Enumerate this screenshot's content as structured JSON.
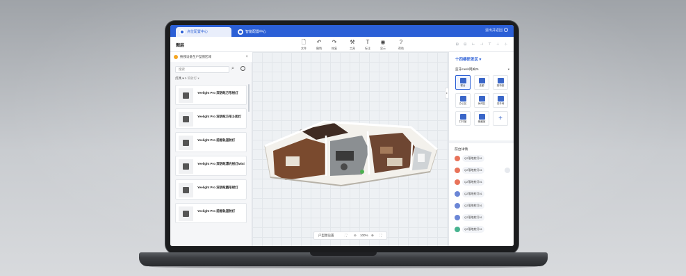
{
  "tabs": [
    {
      "label": "点位配置中心"
    },
    {
      "label": "智能配置中心"
    }
  ],
  "header_right": "退出并返回",
  "toolbar": {
    "title": "图层",
    "tools": [
      {
        "label": "文件",
        "icon": "file-icon"
      },
      {
        "label": "撤销",
        "icon": "undo-icon"
      },
      {
        "label": "恢复",
        "icon": "redo-icon"
      },
      {
        "label": "工具",
        "icon": "tool-icon"
      },
      {
        "label": "标注",
        "icon": "text-icon"
      },
      {
        "label": "显示",
        "icon": "eye-icon"
      },
      {
        "label": "帮助",
        "icon": "help-icon"
      }
    ],
    "right_icons": "⊞ ⊟ ⊢ ⊣ ⊤ ⊥ ⊹"
  },
  "left_panel": {
    "notice": "拖拽设备至户型图区域",
    "search_placeholder": "搜索",
    "breadcrumb_main": "灯具",
    "breadcrumb_sub": "筒射灯",
    "products": [
      {
        "name": "Yeelight Pro 深防眩方形射灯"
      },
      {
        "name": "Yeelight Pro 深防眩方形斗胆灯"
      },
      {
        "name": "Yeelight Pro 前舱轨道射灯"
      },
      {
        "name": "Yeelight Pro 深防眩漂光射灯Mini"
      },
      {
        "name": "Yeelight Pro 深防眩圆形射灯"
      },
      {
        "name": "Yeelight Pro 前舱轨道射灯"
      }
    ]
  },
  "canvas": {
    "zoom_label": "户型图设置",
    "zoom_value": "100%"
  },
  "right_panel": {
    "zone_title": "十四楼研发区",
    "selected_device": "蓝牙mesh网关01",
    "zones": [
      {
        "label": "餐台"
      },
      {
        "label": "走廊"
      },
      {
        "label": "接待室"
      },
      {
        "label": "办公区"
      },
      {
        "label": "休闲区"
      },
      {
        "label": "洗手间"
      },
      {
        "label": "打印室"
      },
      {
        "label": "储藏室"
      }
    ],
    "detail_title": "前台详情",
    "details": [
      {
        "label": "Q2落地射灯01",
        "color": "#e8735a"
      },
      {
        "label": "Q2落地射灯01",
        "color": "#e8735a"
      },
      {
        "label": "Q2落地射灯01",
        "color": "#e8735a"
      },
      {
        "label": "Q2落地射灯01",
        "color": "#6b86d6"
      },
      {
        "label": "Q2落地射灯01",
        "color": "#6b86d6"
      },
      {
        "label": "Q2落地射灯01",
        "color": "#6b86d6"
      },
      {
        "label": "Q2落地射灯01",
        "color": "#47b38f"
      }
    ]
  },
  "colors": {
    "accent": "#2b5fd6",
    "floor_wood": "#7a4a2e",
    "wall": "#f3f1ec"
  }
}
